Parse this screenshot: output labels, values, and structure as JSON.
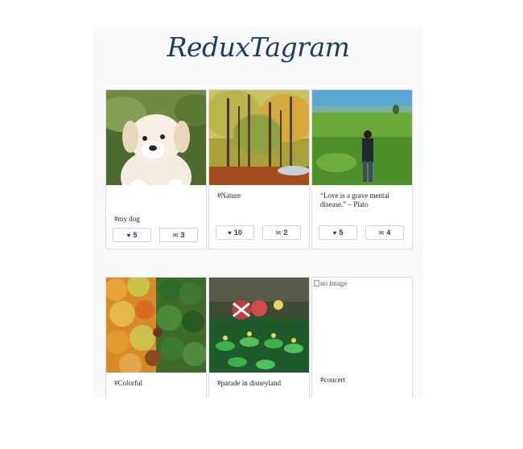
{
  "app": {
    "title": "ReduxTagram"
  },
  "posts": [
    {
      "caption": "#my dog",
      "likes": "5",
      "comments": "3",
      "like_icon": "heart-icon",
      "comment_icon": "comment-icon"
    },
    {
      "caption": "#Nature",
      "likes": "10",
      "comments": "2",
      "like_icon": "heart-icon",
      "comment_icon": "comment-icon"
    },
    {
      "caption": "“Love is a grave mental disease.” – Plato",
      "likes": "5",
      "comments": "4",
      "like_icon": "heart-icon",
      "comment_icon": "comment-icon"
    },
    {
      "caption": "#Colorful"
    },
    {
      "caption": "#parade in disneyland"
    },
    {
      "caption": "#concert",
      "image_alt": "no image"
    }
  ],
  "colors": {
    "brand": "#1e3a68",
    "card_border": "#dcdcdc",
    "background": "#fafafa"
  }
}
